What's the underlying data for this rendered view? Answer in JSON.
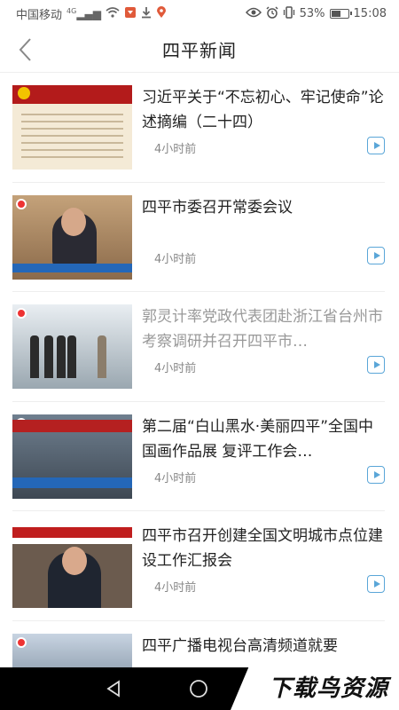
{
  "status_bar": {
    "carrier": "中国移动",
    "signal_label": "4G",
    "battery_percent": "53%",
    "battery_level": 0.53,
    "time": "15:08"
  },
  "header": {
    "title": "四平新闻",
    "back_icon": "chevron-left-icon"
  },
  "news": [
    {
      "title": "习近平关于“不忘初心、牢记使命”论述摘编（二十四）",
      "time": "4小时前",
      "read": false
    },
    {
      "title": "四平市委召开常委会议",
      "time": "4小时前",
      "read": false
    },
    {
      "title": "郭灵计率党政代表团赴浙江省台州市考察调研并召开四平市…",
      "time": "4小时前",
      "read": true
    },
    {
      "title": "第二届“白山黑水·美丽四平”全国中国画作品展 复评工作会…",
      "time": "4小时前",
      "read": false
    },
    {
      "title": "四平市召开创建全国文明城市点位建设工作汇报会",
      "time": "4小时前",
      "read": false
    },
    {
      "title": "四平广播电视台高清频道就要",
      "time": "",
      "read": false
    }
  ],
  "nav_bar": {
    "back_icon": "triangle-back-icon",
    "home_icon": "circle-home-icon"
  },
  "watermark": {
    "text": "下载鸟资源"
  },
  "colors": {
    "accent": "#5aa6d8",
    "read_text": "#999999"
  }
}
